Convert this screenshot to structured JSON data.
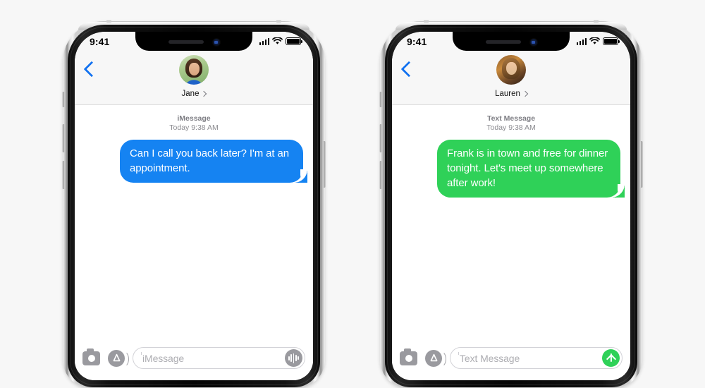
{
  "page": {
    "background": "#f7f7f7"
  },
  "colors": {
    "imessage_blue": "#1583f2",
    "sms_green": "#2fd158",
    "tint_blue": "#1372f0",
    "icon_gray": "#9a9a9f",
    "placeholder_gray": "#adadb2",
    "meta_gray": "#8b8b90"
  },
  "phones": [
    {
      "id": "imessage-phone",
      "status_bar": {
        "time": "9:41",
        "signal_icon": "cellular-signal-icon",
        "wifi_icon": "wifi-icon",
        "battery_icon": "battery-full-icon"
      },
      "header": {
        "back_icon": "back-chevron-icon",
        "avatar_icon": "contact-avatar-jane",
        "contact_name": "Jane",
        "detail_chevron_icon": "chevron-right-icon"
      },
      "thread": {
        "service_label": "iMessage",
        "timestamp": "Today 9:38 AM",
        "messages": [
          {
            "direction": "outgoing",
            "style": "imessage",
            "text": "Can I call you back later? I'm at an appointment."
          }
        ]
      },
      "toolbar": {
        "camera_icon": "camera-icon",
        "apps_icon": "app-store-icon",
        "input_placeholder": "iMessage",
        "action_icon": "audio-message-icon",
        "action_name": "record-audio-button"
      }
    },
    {
      "id": "sms-phone",
      "status_bar": {
        "time": "9:41",
        "signal_icon": "cellular-signal-icon",
        "wifi_icon": "wifi-icon",
        "battery_icon": "battery-full-icon"
      },
      "header": {
        "back_icon": "back-chevron-icon",
        "avatar_icon": "contact-avatar-lauren",
        "contact_name": "Lauren",
        "detail_chevron_icon": "chevron-right-icon"
      },
      "thread": {
        "service_label": "Text Message",
        "timestamp": "Today 9:38 AM",
        "messages": [
          {
            "direction": "outgoing",
            "style": "sms",
            "text": "Frank is in town and free for dinner tonight. Let's meet up somewhere after work!"
          }
        ]
      },
      "toolbar": {
        "camera_icon": "camera-icon",
        "apps_icon": "app-store-icon",
        "input_placeholder": "Text Message",
        "action_icon": "send-arrow-icon",
        "action_name": "send-button"
      }
    }
  ]
}
